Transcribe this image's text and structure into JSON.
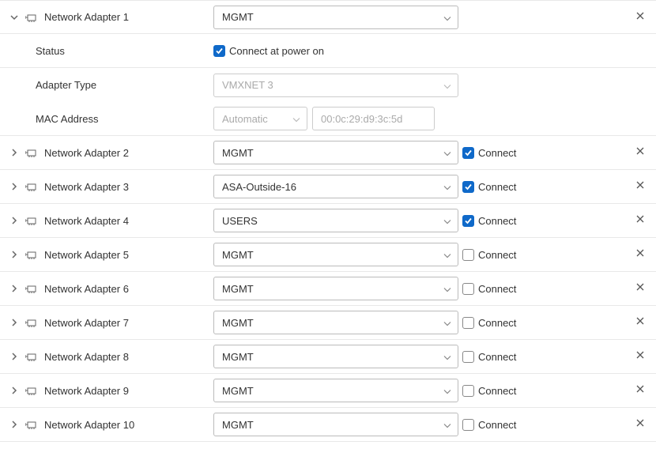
{
  "adapters": [
    {
      "label": "Network Adapter 1",
      "expanded": true,
      "network": "MGMT",
      "connectLabel": "",
      "connectChecked": false,
      "status": {
        "label": "Status",
        "checkLabel": "Connect at power on",
        "checked": true
      },
      "adapterType": {
        "label": "Adapter Type",
        "value": "VMXNET 3"
      },
      "mac": {
        "label": "MAC Address",
        "mode": "Automatic",
        "address": "00:0c:29:d9:3c:5d"
      }
    },
    {
      "label": "Network Adapter 2",
      "expanded": false,
      "network": "MGMT",
      "connectLabel": "Connect",
      "connectChecked": true
    },
    {
      "label": "Network Adapter 3",
      "expanded": false,
      "network": "ASA-Outside-16",
      "connectLabel": "Connect",
      "connectChecked": true
    },
    {
      "label": "Network Adapter 4",
      "expanded": false,
      "network": "USERS",
      "connectLabel": "Connect",
      "connectChecked": true
    },
    {
      "label": "Network Adapter 5",
      "expanded": false,
      "network": "MGMT",
      "connectLabel": "Connect",
      "connectChecked": false
    },
    {
      "label": "Network Adapter 6",
      "expanded": false,
      "network": "MGMT",
      "connectLabel": "Connect",
      "connectChecked": false
    },
    {
      "label": "Network Adapter 7",
      "expanded": false,
      "network": "MGMT",
      "connectLabel": "Connect",
      "connectChecked": false
    },
    {
      "label": "Network Adapter 8",
      "expanded": false,
      "network": "MGMT",
      "connectLabel": "Connect",
      "connectChecked": false
    },
    {
      "label": "Network Adapter 9",
      "expanded": false,
      "network": "MGMT",
      "connectLabel": "Connect",
      "connectChecked": false
    },
    {
      "label": "Network Adapter 10",
      "expanded": false,
      "network": "MGMT",
      "connectLabel": "Connect",
      "connectChecked": false
    }
  ]
}
